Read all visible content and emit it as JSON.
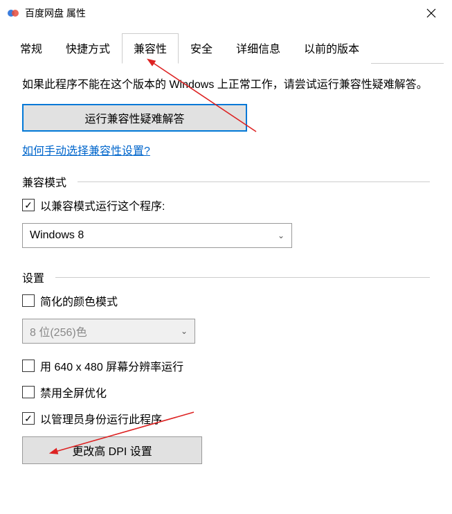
{
  "window": {
    "title": "百度网盘 属性"
  },
  "tabs": [
    {
      "label": "常规"
    },
    {
      "label": "快捷方式"
    },
    {
      "label": "兼容性",
      "active": true
    },
    {
      "label": "安全"
    },
    {
      "label": "详细信息"
    },
    {
      "label": "以前的版本"
    }
  ],
  "description": "如果此程序不能在这个版本的 Windows 上正常工作，请尝试运行兼容性疑难解答。",
  "troubleshoot_button": "运行兼容性疑难解答",
  "manual_link": "如何手动选择兼容性设置?",
  "compat_mode": {
    "legend": "兼容模式",
    "checkbox_label": "以兼容模式运行这个程序:",
    "checked": true,
    "selected_os": "Windows 8"
  },
  "settings": {
    "legend": "设置",
    "reduced_color": {
      "label": "简化的颜色模式",
      "checked": false
    },
    "color_depth": "8 位(256)色",
    "low_res": {
      "label": "用 640 x 480 屏幕分辨率运行",
      "checked": false
    },
    "disable_fullscreen": {
      "label": "禁用全屏优化",
      "checked": false
    },
    "run_admin": {
      "label": "以管理员身份运行此程序",
      "checked": true
    },
    "dpi_button": "更改高 DPI 设置"
  }
}
